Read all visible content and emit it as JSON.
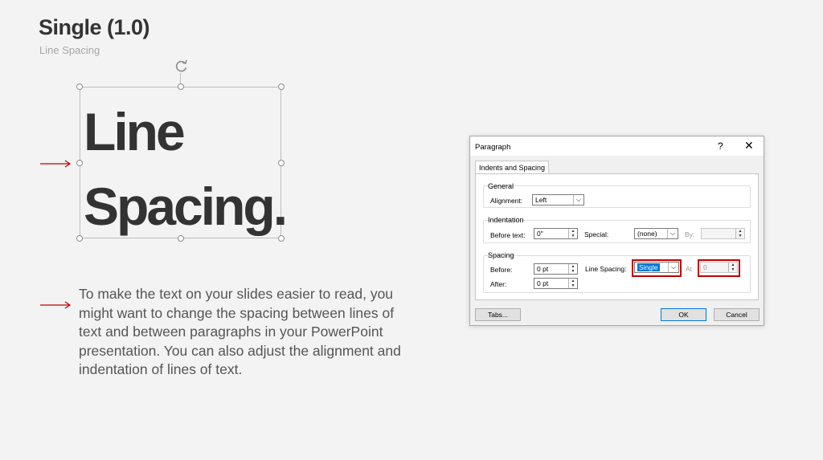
{
  "slide": {
    "title": "Single (1.0)",
    "subtitle": "Line Spacing",
    "big_text_line1": "Line",
    "big_text_line2": "Spacing.",
    "body": "To make the text on your slides easier to read, you might want to change the spacing between lines of text and between paragraphs in your PowerPoint presentation. You can also adjust the alignment and indentation of lines of text.",
    "arrow_color": "#c00000"
  },
  "dialog": {
    "title": "Paragraph",
    "help": "?",
    "close": "✕",
    "tab": "Indents and Spacing",
    "general": {
      "label": "General",
      "alignment_label": "Alignment:",
      "alignment_value": "Left"
    },
    "indentation": {
      "label": "Indentation",
      "before_text_label": "Before text:",
      "before_text_value": "0\"",
      "special_label": "Special:",
      "special_value": "(none)",
      "by_label": "By:",
      "by_value": ""
    },
    "spacing": {
      "label": "Spacing",
      "before_label": "Before:",
      "before_value": "0 pt",
      "after_label": "After:",
      "after_value": "0 pt",
      "line_spacing_label": "Line Spacing:",
      "line_spacing_value": "Single",
      "at_label": "At",
      "at_value": "0"
    },
    "buttons": {
      "tabs": "Tabs...",
      "ok": "OK",
      "cancel": "Cancel"
    },
    "highlight_color": "#c00000"
  }
}
